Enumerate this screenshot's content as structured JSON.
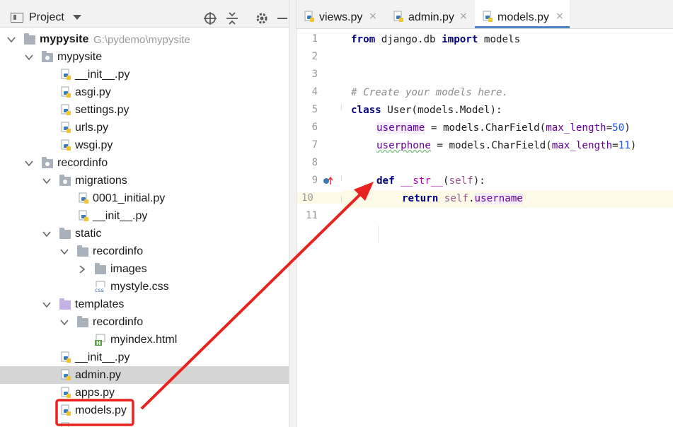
{
  "project_panel": {
    "title": "Project",
    "tree": [
      {
        "label": "mypysite",
        "path": "G:\\pydemo\\mypysite",
        "bold": true
      },
      {
        "label": "mypysite"
      },
      {
        "label": "__init__.py"
      },
      {
        "label": "asgi.py"
      },
      {
        "label": "settings.py"
      },
      {
        "label": "urls.py"
      },
      {
        "label": "wsgi.py"
      },
      {
        "label": "recordinfo"
      },
      {
        "label": "migrations"
      },
      {
        "label": "0001_initial.py"
      },
      {
        "label": "__init__.py"
      },
      {
        "label": "static"
      },
      {
        "label": "recordinfo"
      },
      {
        "label": "images"
      },
      {
        "label": "mystyle.css",
        "icon_text": "css"
      },
      {
        "label": "templates"
      },
      {
        "label": "recordinfo"
      },
      {
        "label": "myindex.html",
        "icon_text": "H"
      },
      {
        "label": "__init__.py"
      },
      {
        "label": "admin.py"
      },
      {
        "label": "apps.py"
      },
      {
        "label": "models.py"
      }
    ]
  },
  "tabs": [
    {
      "label": "views.py",
      "close": "×"
    },
    {
      "label": "admin.py",
      "close": "×"
    },
    {
      "label": "models.py",
      "close": "×"
    }
  ],
  "editor": {
    "line_numbers": [
      "1",
      "2",
      "3",
      "4",
      "5",
      "6",
      "7",
      "8",
      "9",
      "10",
      "11"
    ],
    "code": {
      "l1_from": "from",
      "l1_mod": " django.db ",
      "l1_import": "import",
      "l1_rest": " models",
      "l4_comment": "# Create your models here.",
      "l5_class": "class",
      "l5_rest": " User(models.Model):",
      "l6_name": "username",
      "l6_mid": " = models.CharField(",
      "l6_param": "max_length",
      "l6_eq": "=",
      "l6_num": "50",
      "l6_end": ")",
      "l7_name": "userphone",
      "l7_mid": " = models.CharField(",
      "l7_param": "max_length",
      "l7_eq": "=",
      "l7_num": "11",
      "l7_end": ")",
      "l9_def": "def",
      "l9_fn": "__str__",
      "l9_open": "(",
      "l9_self": "self",
      "l9_end": "):",
      "l10_return": "return",
      "l10_self": "self",
      "l10_dot": ".",
      "l10_attr": "username"
    }
  },
  "colors": {
    "annotation_red": "#e8231f",
    "tab_accent": "#4a86c7",
    "selected_row": "#d5d5d5"
  }
}
